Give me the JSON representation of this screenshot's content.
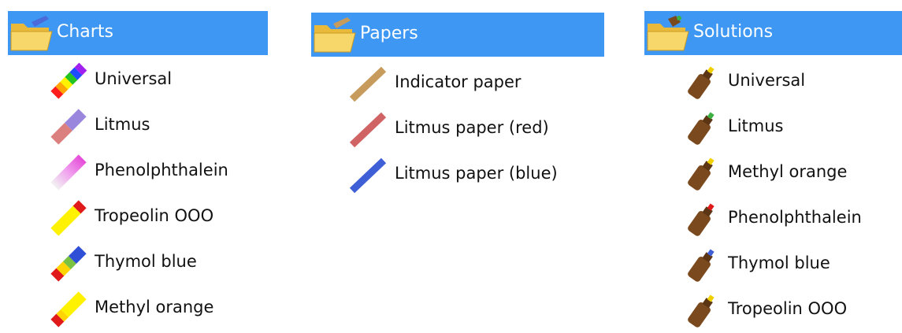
{
  "charts": {
    "title": "Charts",
    "folder_icon": "folder-open-icon",
    "items": [
      {
        "label": "Universal",
        "icon": "universal-chart-icon",
        "colors": [
          "#ff1c1c",
          "#ffa500",
          "#fff200",
          "#22c322",
          "#1e4cff",
          "#a020f0"
        ]
      },
      {
        "label": "Litmus",
        "icon": "litmus-chart-icon",
        "colors": [
          "#dc7f7f",
          "#9a86dc"
        ]
      },
      {
        "label": "Phenolphthalein",
        "icon": "phenolphthalein-chart-icon",
        "colors": [
          "#f2f2f2",
          "#f0a0ee",
          "#e54ad8"
        ]
      },
      {
        "label": "Tropeolin OOO",
        "icon": "tropeolin-chart-icon",
        "colors": [
          "#fff200",
          "#ffe600",
          "#e01a1a"
        ]
      },
      {
        "label": "Thymol blue",
        "icon": "thymol-blue-chart-icon",
        "colors": [
          "#e01a1a",
          "#ffd400",
          "#7bc142",
          "#2e4fd6"
        ]
      },
      {
        "label": "Methyl orange",
        "icon": "methyl-orange-chart-icon",
        "colors": [
          "#e01a1a",
          "#ffd400",
          "#fff200"
        ]
      }
    ]
  },
  "papers": {
    "title": "Papers",
    "folder_icon": "folder-open-icon",
    "items": [
      {
        "label": "Indicator paper",
        "icon": "indicator-paper-icon",
        "color": "#c79b5c"
      },
      {
        "label": "Litmus paper (red)",
        "icon": "litmus-paper-red-icon",
        "color": "#d06464"
      },
      {
        "label": "Litmus paper (blue)",
        "icon": "litmus-paper-blue-icon",
        "color": "#3f5fd6"
      }
    ]
  },
  "solutions": {
    "title": "Solutions",
    "folder_icon": "folder-open-icon",
    "items": [
      {
        "label": "Universal",
        "icon": "bottle-icon",
        "cap_color": "#f0d000"
      },
      {
        "label": "Litmus",
        "icon": "bottle-icon",
        "cap_color": "#3cb043"
      },
      {
        "label": "Methyl orange",
        "icon": "bottle-icon",
        "cap_color": "#f0d000"
      },
      {
        "label": "Phenolphthalein",
        "icon": "bottle-icon",
        "cap_color": "#e01a1a"
      },
      {
        "label": "Thymol blue",
        "icon": "bottle-icon",
        "cap_color": "#3f5fd6"
      },
      {
        "label": "Tropeolin OOO",
        "icon": "bottle-icon",
        "cap_color": "#f0d000"
      }
    ]
  },
  "colors": {
    "header_bg": "#3d97f3",
    "folder": "#f4cf57",
    "bottle": "#7a4a1e"
  }
}
